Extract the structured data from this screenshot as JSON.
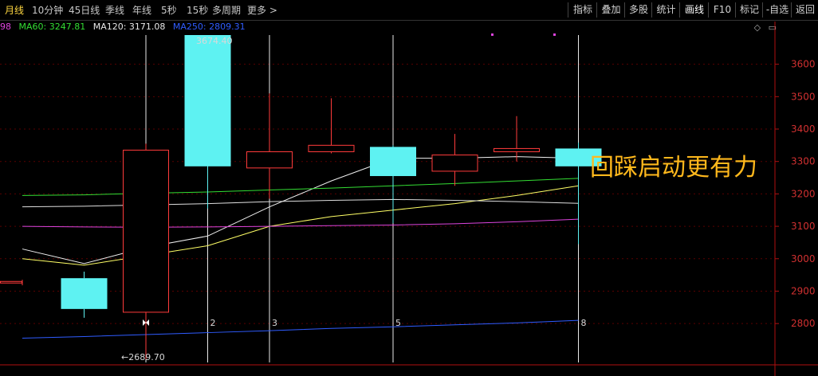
{
  "toolbar": {
    "periods": [
      "月线",
      "10分钟",
      "45日线",
      "季线",
      "年线",
      "5秒",
      "15秒",
      "多周期",
      "更多 >"
    ],
    "active_period": "月线",
    "buttons": [
      "指标",
      "叠加",
      "多股",
      "统计",
      "画线",
      "F10",
      "标记",
      "-自选",
      "返回"
    ],
    "highlighted_button": "画线"
  },
  "ma_legend": {
    "partial": "98",
    "ma60": "MA60: 3247.81",
    "ma120": "MA120: 3171.08",
    "ma250": "MA250: 2809.31",
    "colors": {
      "ma60": "#33dd33",
      "ma120": "#ffffff",
      "ma250": "#2f5cff",
      "ma_yellow": "#ffff66",
      "ma_purple": "#dd44dd"
    }
  },
  "annotation": {
    "text": "回踩启动更有力",
    "color": "#ffb81c"
  },
  "chart_data": {
    "type": "candlestick",
    "y_axis": {
      "ylim": [
        2680,
        3690
      ],
      "ticks": [
        2800,
        2900,
        3000,
        3100,
        3200,
        3300,
        3400,
        3500,
        3600
      ]
    },
    "up_color": "#ff3b3b",
    "down_color": "#5ef2f2",
    "candles": [
      {
        "open": 2930,
        "close": 2930,
        "high": 2935,
        "low": 2918,
        "partial": true
      },
      {
        "open": 2940,
        "close": 2845,
        "high": 2960,
        "low": 2818
      },
      {
        "open": 2835,
        "close": 3335,
        "high": 3355,
        "low": 2690
      },
      {
        "open": 3690,
        "close": 3285,
        "high": 3690,
        "low": 3155
      },
      {
        "open": 3280,
        "close": 3330,
        "high": 3510,
        "low": 3185
      },
      {
        "open": 3330,
        "close": 3350,
        "high": 3495,
        "low": 3325
      },
      {
        "open": 3345,
        "close": 3255,
        "high": 3350,
        "low": 3110
      },
      {
        "open": 3270,
        "close": 3320,
        "high": 3385,
        "low": 3225
      },
      {
        "open": 3330,
        "close": 3340,
        "high": 3440,
        "low": 3300
      },
      {
        "open": 3340,
        "close": 3285,
        "high": 3358,
        "low": 3045
      }
    ],
    "lines": [
      {
        "name": "white",
        "color": "#f0f0f0",
        "values": [
          3030,
          2985,
          3035,
          3070,
          3160,
          3240,
          3310,
          3310,
          3315,
          3310
        ]
      },
      {
        "name": "yellow",
        "color": "#ffff66",
        "values": [
          3000,
          2980,
          3010,
          3040,
          3100,
          3130,
          3150,
          3170,
          3195,
          3225
        ]
      },
      {
        "name": "green",
        "color": "#33dd33",
        "values": [
          3195,
          3197,
          3202,
          3206,
          3212,
          3218,
          3225,
          3232,
          3240,
          3248
        ]
      },
      {
        "name": "ma120",
        "color": "#dddddd",
        "values": [
          3160,
          3162,
          3166,
          3170,
          3176,
          3180,
          3183,
          3180,
          3176,
          3171
        ]
      },
      {
        "name": "purple",
        "color": "#dd44dd",
        "values": [
          3100,
          3098,
          3097,
          3098,
          3100,
          3102,
          3104,
          3108,
          3114,
          3122
        ]
      },
      {
        "name": "ma250",
        "color": "#2f5cff",
        "values": [
          2755,
          2760,
          2766,
          2772,
          2778,
          2785,
          2790,
          2796,
          2802,
          2810
        ]
      }
    ],
    "markers": [
      {
        "candle": 2,
        "label": ""
      },
      {
        "candle": 3,
        "label": "2"
      },
      {
        "candle": 4,
        "label": "3"
      },
      {
        "candle": 6,
        "label": "5"
      },
      {
        "candle": 9,
        "label": "8"
      }
    ],
    "high_label": "3674.40",
    "low_label": "←2689.70"
  }
}
